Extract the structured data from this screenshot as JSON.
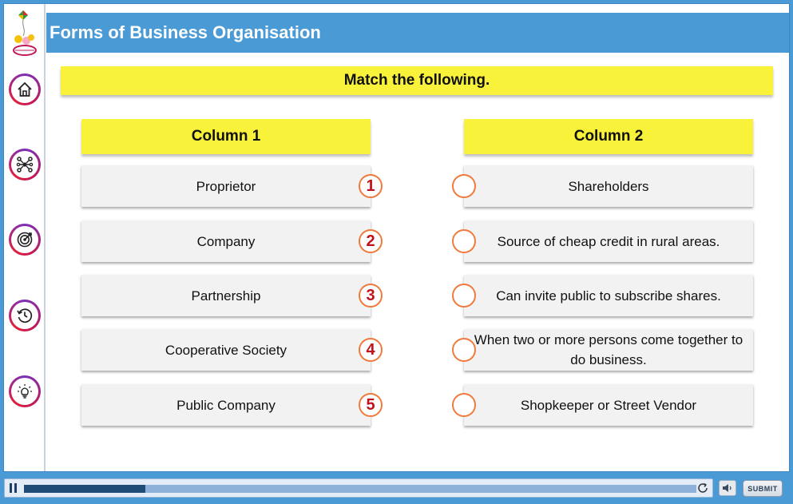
{
  "header": {
    "title": "Forms of Business Organisation"
  },
  "sidebar": {
    "items": [
      {
        "icon": "home-icon"
      },
      {
        "icon": "network-icon"
      },
      {
        "icon": "target-icon"
      },
      {
        "icon": "history-icon"
      },
      {
        "icon": "lightbulb-icon"
      }
    ]
  },
  "instruction": "Match the following.",
  "column1": {
    "heading": "Column 1",
    "items": [
      {
        "number": "1",
        "text": "Proprietor"
      },
      {
        "number": "2",
        "text": "Company"
      },
      {
        "number": "3",
        "text": "Partnership"
      },
      {
        "number": "4",
        "text": "Cooperative Society"
      },
      {
        "number": "5",
        "text": "Public Company"
      }
    ]
  },
  "column2": {
    "heading": "Column 2",
    "items": [
      {
        "text": "Shareholders"
      },
      {
        "text": "Source of cheap credit in rural areas."
      },
      {
        "text": "Can invite public to subscribe shares."
      },
      {
        "text": "When two or more persons come together to do business."
      },
      {
        "text": "Shopkeeper or Street Vendor"
      }
    ]
  },
  "player": {
    "progress": 0.18,
    "submit_label": "SUBMIT"
  },
  "colors": {
    "accent": "#4a9ad6",
    "highlight": "#f9f23a",
    "number_color": "#c1121c",
    "circle_border": "#f07a3c"
  }
}
